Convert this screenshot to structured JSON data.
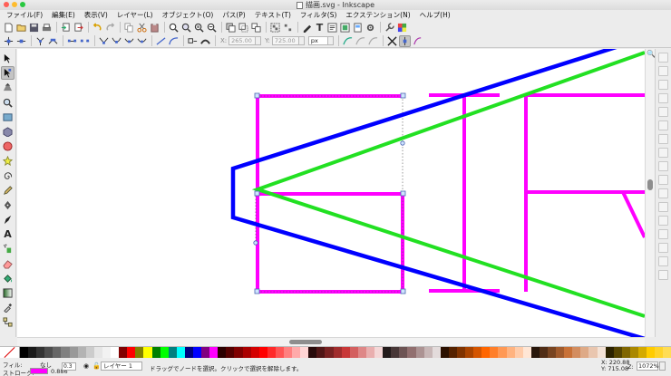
{
  "window": {
    "title": "描画.svg - Inkscape"
  },
  "menu": [
    "ファイル(F)",
    "編集(E)",
    "表示(V)",
    "レイヤー(L)",
    "オブジェクト(O)",
    "パス(P)",
    "テキスト(T)",
    "フィルタ(S)",
    "エクステンション(N)",
    "ヘルプ(H)"
  ],
  "tool_controls": {
    "x_label": "X:",
    "x_value": "265.00",
    "y_label": "Y:",
    "y_value": "725.00",
    "unit": "px"
  },
  "palette": [
    "#000000",
    "#1a1a1a",
    "#333333",
    "#4d4d4d",
    "#666666",
    "#808080",
    "#999999",
    "#b3b3b3",
    "#cccccc",
    "#e6e6e6",
    "#f2f2f2",
    "#ffffff",
    "#800000",
    "#ff0000",
    "#808000",
    "#ffff00",
    "#008000",
    "#00ff00",
    "#008080",
    "#00ffff",
    "#000080",
    "#0000ff",
    "#800080",
    "#ff00ff",
    "#2b0000",
    "#550000",
    "#800000",
    "#aa0000",
    "#d40000",
    "#ff0000",
    "#ff2a2a",
    "#ff5555",
    "#ff8080",
    "#ffaaaa",
    "#ffd5d5",
    "#280b0b",
    "#501616",
    "#782121",
    "#a02c2c",
    "#c83737",
    "#d35f5f",
    "#de8787",
    "#e9afaf",
    "#f4d7d7",
    "#241c1c",
    "#483737",
    "#6c5353",
    "#916f6f",
    "#ac9393",
    "#c8b7b7",
    "#e3dbdb",
    "#2b1100",
    "#552200",
    "#803300",
    "#aa4400",
    "#d45500",
    "#ff6600",
    "#ff7f2a",
    "#ff9955",
    "#ffb380",
    "#ffccaa",
    "#ffe6d5",
    "#28170b",
    "#502d16",
    "#784421",
    "#a05a2c",
    "#c87137",
    "#d38d5f",
    "#deaa87",
    "#e9c6af",
    "#f4e3d7",
    "#2b2200",
    "#554400",
    "#806600",
    "#aa8800",
    "#d4aa00",
    "#ffcc00",
    "#ffd42a",
    "#ffdd55"
  ],
  "status": {
    "fill_label": "フィル:",
    "fill_value": "なし",
    "stroke_label": "ストローク:",
    "stroke_color": "#ff00ff",
    "stroke_width": "0.886",
    "opacity": "0.3",
    "layer": "レイヤー 1",
    "message": "ドラッグでノードを選択。クリックで選択を解除します。",
    "x": "X:  220.88",
    "y": "Y:  715.08",
    "zoom_label": "Z:",
    "zoom": "1072%"
  }
}
